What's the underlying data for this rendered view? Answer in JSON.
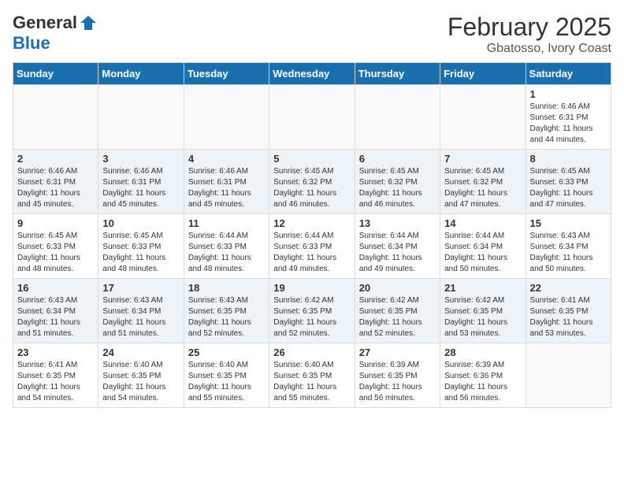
{
  "header": {
    "logo_general": "General",
    "logo_blue": "Blue",
    "month": "February 2025",
    "location": "Gbatosso, Ivory Coast"
  },
  "weekdays": [
    "Sunday",
    "Monday",
    "Tuesday",
    "Wednesday",
    "Thursday",
    "Friday",
    "Saturday"
  ],
  "weeks": [
    [
      {
        "day": "",
        "info": ""
      },
      {
        "day": "",
        "info": ""
      },
      {
        "day": "",
        "info": ""
      },
      {
        "day": "",
        "info": ""
      },
      {
        "day": "",
        "info": ""
      },
      {
        "day": "",
        "info": ""
      },
      {
        "day": "1",
        "info": "Sunrise: 6:46 AM\nSunset: 6:31 PM\nDaylight: 11 hours\nand 44 minutes."
      }
    ],
    [
      {
        "day": "2",
        "info": "Sunrise: 6:46 AM\nSunset: 6:31 PM\nDaylight: 11 hours\nand 45 minutes."
      },
      {
        "day": "3",
        "info": "Sunrise: 6:46 AM\nSunset: 6:31 PM\nDaylight: 11 hours\nand 45 minutes."
      },
      {
        "day": "4",
        "info": "Sunrise: 6:46 AM\nSunset: 6:31 PM\nDaylight: 11 hours\nand 45 minutes."
      },
      {
        "day": "5",
        "info": "Sunrise: 6:45 AM\nSunset: 6:32 PM\nDaylight: 11 hours\nand 46 minutes."
      },
      {
        "day": "6",
        "info": "Sunrise: 6:45 AM\nSunset: 6:32 PM\nDaylight: 11 hours\nand 46 minutes."
      },
      {
        "day": "7",
        "info": "Sunrise: 6:45 AM\nSunset: 6:32 PM\nDaylight: 11 hours\nand 47 minutes."
      },
      {
        "day": "8",
        "info": "Sunrise: 6:45 AM\nSunset: 6:33 PM\nDaylight: 11 hours\nand 47 minutes."
      }
    ],
    [
      {
        "day": "9",
        "info": "Sunrise: 6:45 AM\nSunset: 6:33 PM\nDaylight: 11 hours\nand 48 minutes."
      },
      {
        "day": "10",
        "info": "Sunrise: 6:45 AM\nSunset: 6:33 PM\nDaylight: 11 hours\nand 48 minutes."
      },
      {
        "day": "11",
        "info": "Sunrise: 6:44 AM\nSunset: 6:33 PM\nDaylight: 11 hours\nand 48 minutes."
      },
      {
        "day": "12",
        "info": "Sunrise: 6:44 AM\nSunset: 6:33 PM\nDaylight: 11 hours\nand 49 minutes."
      },
      {
        "day": "13",
        "info": "Sunrise: 6:44 AM\nSunset: 6:34 PM\nDaylight: 11 hours\nand 49 minutes."
      },
      {
        "day": "14",
        "info": "Sunrise: 6:44 AM\nSunset: 6:34 PM\nDaylight: 11 hours\nand 50 minutes."
      },
      {
        "day": "15",
        "info": "Sunrise: 6:43 AM\nSunset: 6:34 PM\nDaylight: 11 hours\nand 50 minutes."
      }
    ],
    [
      {
        "day": "16",
        "info": "Sunrise: 6:43 AM\nSunset: 6:34 PM\nDaylight: 11 hours\nand 51 minutes."
      },
      {
        "day": "17",
        "info": "Sunrise: 6:43 AM\nSunset: 6:34 PM\nDaylight: 11 hours\nand 51 minutes."
      },
      {
        "day": "18",
        "info": "Sunrise: 6:43 AM\nSunset: 6:35 PM\nDaylight: 11 hours\nand 52 minutes."
      },
      {
        "day": "19",
        "info": "Sunrise: 6:42 AM\nSunset: 6:35 PM\nDaylight: 11 hours\nand 52 minutes."
      },
      {
        "day": "20",
        "info": "Sunrise: 6:42 AM\nSunset: 6:35 PM\nDaylight: 11 hours\nand 52 minutes."
      },
      {
        "day": "21",
        "info": "Sunrise: 6:42 AM\nSunset: 6:35 PM\nDaylight: 11 hours\nand 53 minutes."
      },
      {
        "day": "22",
        "info": "Sunrise: 6:41 AM\nSunset: 6:35 PM\nDaylight: 11 hours\nand 53 minutes."
      }
    ],
    [
      {
        "day": "23",
        "info": "Sunrise: 6:41 AM\nSunset: 6:35 PM\nDaylight: 11 hours\nand 54 minutes."
      },
      {
        "day": "24",
        "info": "Sunrise: 6:40 AM\nSunset: 6:35 PM\nDaylight: 11 hours\nand 54 minutes."
      },
      {
        "day": "25",
        "info": "Sunrise: 6:40 AM\nSunset: 6:35 PM\nDaylight: 11 hours\nand 55 minutes."
      },
      {
        "day": "26",
        "info": "Sunrise: 6:40 AM\nSunset: 6:35 PM\nDaylight: 11 hours\nand 55 minutes."
      },
      {
        "day": "27",
        "info": "Sunrise: 6:39 AM\nSunset: 6:35 PM\nDaylight: 11 hours\nand 56 minutes."
      },
      {
        "day": "28",
        "info": "Sunrise: 6:39 AM\nSunset: 6:36 PM\nDaylight: 11 hours\nand 56 minutes."
      },
      {
        "day": "",
        "info": ""
      }
    ]
  ]
}
